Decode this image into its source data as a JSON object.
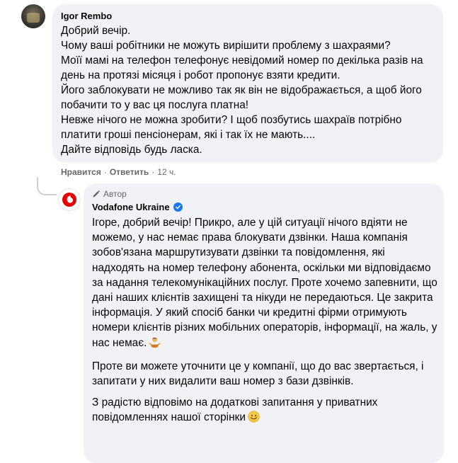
{
  "comment1": {
    "author": "Igor Rembo",
    "text": "Добрий вечір.\nЧому ваші робітники не можуть вирішити проблему з шахраями?\nМоїї мамі на телефон телефонує невідомий номер по декілька разів на день на протязі місяця і робот пропонує взяти кредити.\nЙого заблокувати не можливо так як він не відображається, а щоб його побачити то у вас ця послуга платна!\nНевже нічого не можна зробити? І щоб позбутись шахраїв потрібно платити гроші пенсіонерам, які і так їх не мають....\nДайте відповідь будь ласка.",
    "like_label": "Нравится",
    "separator": "·",
    "reply_label": "Ответить",
    "time": "12 ч."
  },
  "reply": {
    "badge": "Автор",
    "author": "Vodafone Ukraine",
    "paragraphs": [
      "Ігоре, добрий вечір! Прикро, але у цій ситуації нічого вдіяти не можемо, у нас немає права блокувати дзвінки. Наша компанія зобов'язана маршрутизувати дзвінки та повідомлення, які надходять на номер телефону абонента, оскільки ми відповідаємо за надання телекомунікаційних послуг. Проте хочемо запевнити, що дані наших клієнтів захищені та нікуди не передаються. Це закрита інформація. У який спосіб банки чи кредитні фірми отримують номери клієнтів різних мобільних операторів, інформації, на жаль, у нас немає.",
      "Проте ви можете уточнити це у компанії, що до вас звертається, і запитати у них видалити ваш номер з бази дзвінків.",
      "З радістю відповімо на додаткові запитання у приватних повідомленнях нашої сторінки"
    ]
  },
  "colors": {
    "bubble": "#f0f2f5",
    "verified": "#1877f2",
    "vodafone_red": "#e60000",
    "meta_text": "#65676b"
  },
  "icons": [
    "pen-icon",
    "verified-badge-icon",
    "vodafone-logo-icon",
    "person-shrug-emoji-icon",
    "smile-emoji-icon"
  ]
}
